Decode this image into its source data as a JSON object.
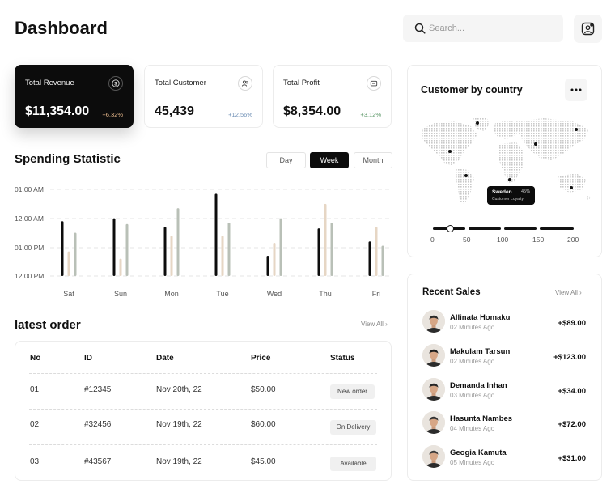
{
  "header": {
    "title": "Dashboard",
    "search_placeholder": "Search..."
  },
  "stats": [
    {
      "label": "Total Revenue",
      "value": "$11,354.00",
      "change": "+6,32%",
      "icon": "dollar-icon",
      "change_color": "#e8b98c"
    },
    {
      "label": "Total Customer",
      "value": "45,439",
      "change": "+12.56%",
      "icon": "users-icon",
      "change_color": "#6e8fb5"
    },
    {
      "label": "Total Profit",
      "value": "$8,354.00",
      "change": "+3,12%",
      "icon": "wallet-icon",
      "change_color": "#5f9a6b"
    }
  ],
  "spending": {
    "title": "Spending Statistic",
    "tabs": [
      "Day",
      "Week",
      "Month"
    ],
    "active_tab": "Week"
  },
  "chart_data": {
    "type": "bar",
    "title": "Spending Statistic",
    "y_tick_labels": [
      "01.00 AM",
      "12.00 AM",
      "01.00 PM",
      "12.00 PM"
    ],
    "categories": [
      "Sat",
      "Sun",
      "Mon",
      "Tue",
      "Wed",
      "Thu",
      "Fri"
    ],
    "ylim": [
      0,
      3
    ],
    "series": [
      {
        "color": "#0c0c0c",
        "values": [
          1.9,
          2.0,
          1.7,
          2.85,
          0.7,
          1.65,
          1.2
        ]
      },
      {
        "color": "#e6d6c4",
        "values": [
          0.85,
          0.6,
          1.4,
          1.4,
          1.15,
          2.5,
          1.7
        ]
      },
      {
        "color": "#b9c0b7",
        "values": [
          1.5,
          1.8,
          2.35,
          1.85,
          2.0,
          1.85,
          1.05
        ]
      }
    ],
    "grid": true
  },
  "orders": {
    "title": "latest order",
    "view_all": "View All",
    "columns": [
      "No",
      "ID",
      "Date",
      "Price",
      "Status"
    ],
    "rows": [
      {
        "no": "01",
        "id": "#12345",
        "date": "Nov 20th, 22",
        "price": "$50.00",
        "status": "New order"
      },
      {
        "no": "02",
        "id": "#32456",
        "date": "Nov 19th, 22",
        "price": "$60.00",
        "status": "On Delivery"
      },
      {
        "no": "03",
        "id": "#43567",
        "date": "Nov 19th, 22",
        "price": "$45.00",
        "status": "Available"
      }
    ]
  },
  "country": {
    "title": "Customer by country",
    "tooltip_country": "Sweden",
    "tooltip_percent": "45%",
    "tooltip_sub": "Customer Loyalty",
    "scale_labels": [
      "0",
      "50",
      "100",
      "150",
      "200"
    ],
    "slider_value": 25
  },
  "recent_sales": {
    "title": "Recent Sales",
    "view_all": "View All",
    "items": [
      {
        "name": "Allinata Homaku",
        "time": "02 Minutes Ago",
        "amount": "+$89.00"
      },
      {
        "name": "Makulam Tarsun",
        "time": "02 Minutes Ago",
        "amount": "+$123.00"
      },
      {
        "name": "Demanda Inhan",
        "time": "03 Minutes Ago",
        "amount": "+$34.00"
      },
      {
        "name": "Hasunta Nambes",
        "time": "04 Minutes Ago",
        "amount": "+$72.00"
      },
      {
        "name": "Geogia Kamuta",
        "time": "05 Minutes Ago",
        "amount": "+$31.00"
      }
    ]
  }
}
